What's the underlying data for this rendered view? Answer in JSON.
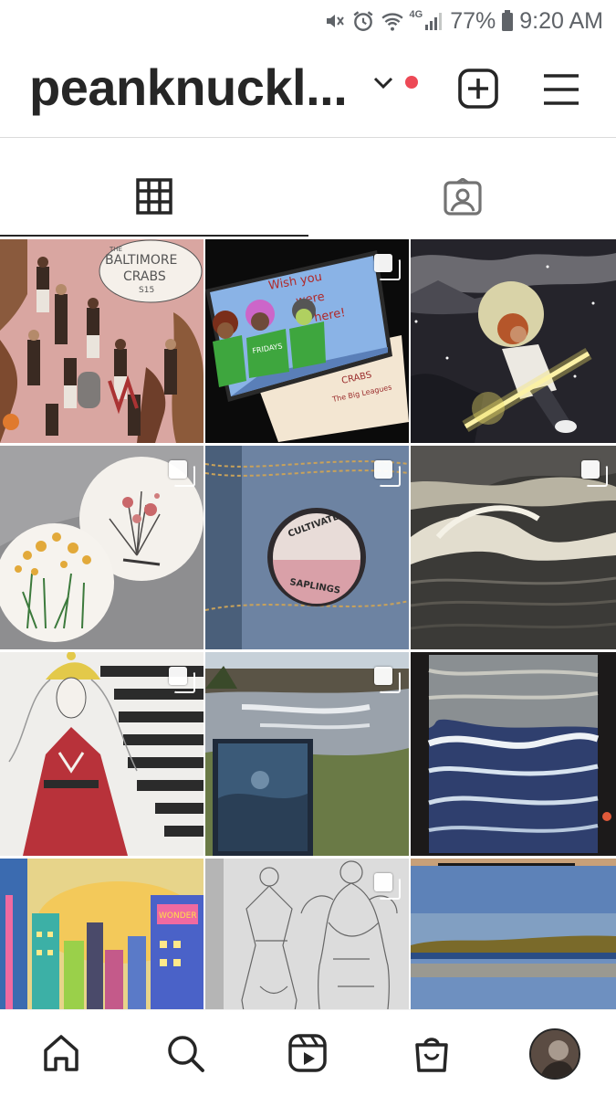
{
  "status_bar": {
    "network": "4G",
    "battery_percent": "77%",
    "time": "9:20 AM",
    "icons": [
      "mute-icon",
      "alarm-icon",
      "wifi-icon",
      "signal-icon",
      "battery-icon"
    ]
  },
  "header": {
    "username": "peanknuckl...",
    "has_notification": true,
    "notification_color": "#ed4956",
    "icons": [
      "chevron-down-icon",
      "new-post-icon",
      "menu-icon"
    ]
  },
  "tabs": [
    {
      "icon": "grid-icon",
      "selected": true
    },
    {
      "icon": "tagged-icon",
      "selected": false
    }
  ],
  "posts": [
    {
      "name": "post-baltimore-crabs",
      "multi": false,
      "alt_text": [
        "THE",
        "BALTIMORE",
        "CRABS",
        "S15"
      ]
    },
    {
      "name": "post-postcard",
      "multi": true,
      "alt_text": [
        "Wish you",
        "were",
        "here!",
        "FRIDAYS",
        "CRABS",
        "The Big Leagues"
      ]
    },
    {
      "name": "post-moon-warrior",
      "multi": false
    },
    {
      "name": "post-embroidery-hoops",
      "multi": true
    },
    {
      "name": "post-denim-patch",
      "multi": true,
      "alt_text": [
        "CULTIVATE",
        "SAPLINGS"
      ]
    },
    {
      "name": "post-ocean-wave",
      "multi": true
    },
    {
      "name": "post-red-dress-drawing",
      "multi": true
    },
    {
      "name": "post-river-painting",
      "multi": true
    },
    {
      "name": "post-blue-sea-painting",
      "multi": false
    },
    {
      "name": "post-city-drawing",
      "multi": false,
      "alt_text": [
        "WONDER"
      ]
    },
    {
      "name": "post-sketchbook",
      "multi": true
    },
    {
      "name": "post-lake-painting",
      "multi": false
    }
  ],
  "bottom_nav": [
    "home-icon",
    "search-icon",
    "reels-icon",
    "shop-icon",
    "profile-avatar"
  ],
  "colors": {
    "text": "#262626",
    "divider": "#dbdbdb",
    "accent": "#ed4956"
  }
}
